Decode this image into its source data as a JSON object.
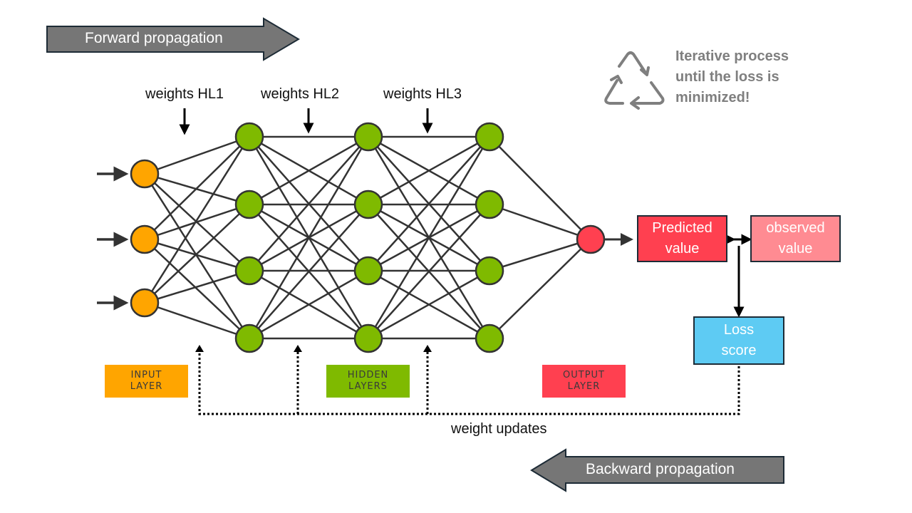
{
  "colors": {
    "input": "#ffa500",
    "hidden": "#7fba00",
    "output": "#ff4050",
    "predicted": "#ff4050",
    "observed": "#ff8b92",
    "loss": "#5ecbf3",
    "arrow_fill": "#767676",
    "arrow_stroke": "#1d2b36",
    "edge": "#333333",
    "iter_gray": "#7f7f7f"
  },
  "forward": {
    "label": "Forward propagation"
  },
  "backward": {
    "label": "Backward propagation"
  },
  "iterative": {
    "icon": "recycle-icon",
    "lines": [
      "Iterative process",
      "until the loss is",
      "minimized!"
    ]
  },
  "weights": [
    "weights HL1",
    "weights HL2",
    "weights HL3"
  ],
  "network": {
    "layers": [
      {
        "name": "input",
        "count": 3
      },
      {
        "name": "hidden1",
        "count": 4
      },
      {
        "name": "hidden2",
        "count": 4
      },
      {
        "name": "hidden3",
        "count": 4
      },
      {
        "name": "output",
        "count": 1
      }
    ]
  },
  "legend": {
    "input": [
      "INPUT",
      "LAYER"
    ],
    "hidden": [
      "HIDDEN",
      "LAYERS"
    ],
    "output": [
      "OUTPUT",
      "LAYER"
    ]
  },
  "boxes": {
    "predicted": [
      "Predicted",
      "value"
    ],
    "observed": [
      "observed",
      "value"
    ],
    "loss": [
      "Loss",
      "score"
    ]
  },
  "weight_updates": "weight updates"
}
